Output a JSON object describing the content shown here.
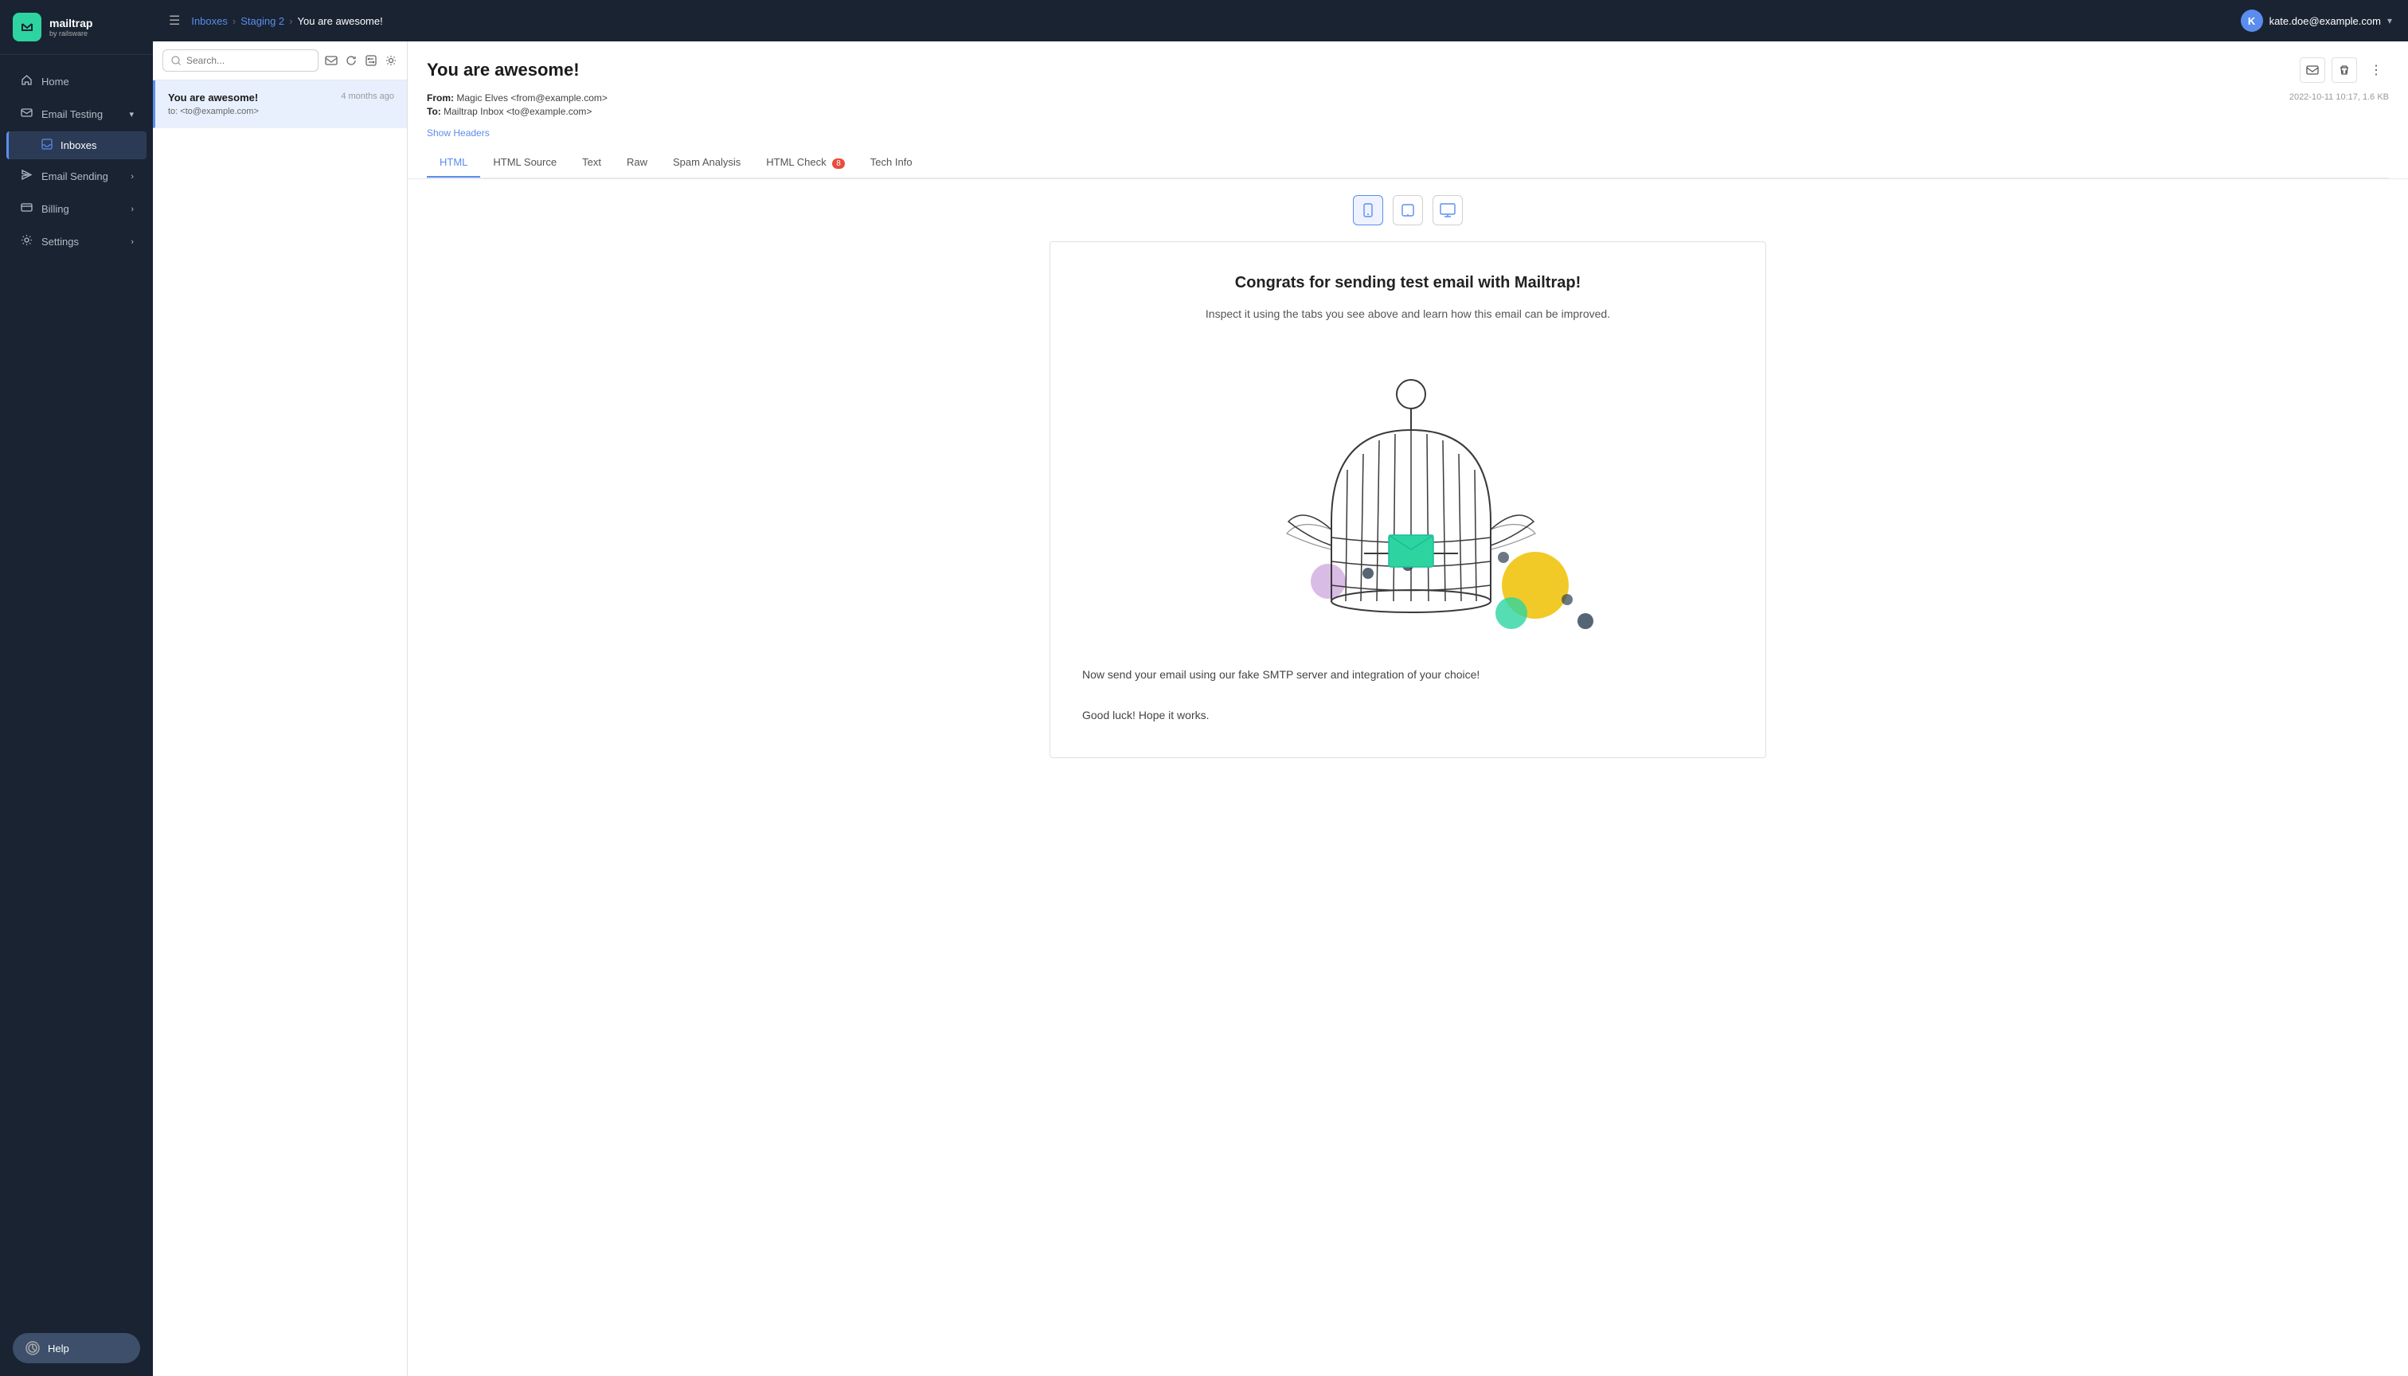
{
  "sidebar": {
    "logo": {
      "icon": "M",
      "main": "mailtrap",
      "sub": "by railsware"
    },
    "nav": [
      {
        "id": "home",
        "label": "Home",
        "icon": "🏠",
        "hasChevron": false
      },
      {
        "id": "email-testing",
        "label": "Email Testing",
        "icon": "✉️",
        "hasChevron": true,
        "expanded": true
      },
      {
        "id": "inboxes",
        "label": "Inboxes",
        "icon": "📥",
        "isSubItem": true,
        "active": true
      },
      {
        "id": "email-sending",
        "label": "Email Sending",
        "icon": "✈️",
        "hasChevron": true
      },
      {
        "id": "billing",
        "label": "Billing",
        "icon": "💳",
        "hasChevron": true
      },
      {
        "id": "settings",
        "label": "Settings",
        "icon": "⚙️",
        "hasChevron": true
      }
    ],
    "help_label": "Help"
  },
  "topbar": {
    "breadcrumb": {
      "inboxes": "Inboxes",
      "staging2": "Staging 2",
      "current": "You are awesome!"
    },
    "user": {
      "avatar": "K",
      "email": "kate.doe@example.com"
    }
  },
  "email_list": {
    "search_placeholder": "Search...",
    "items": [
      {
        "subject": "You are awesome!",
        "to": "to: <to@example.com>",
        "time": "4 months ago",
        "active": true
      }
    ]
  },
  "email_detail": {
    "title": "You are awesome!",
    "from": "Magic Elves <from@example.com>",
    "to": "Mailtrap Inbox <to@example.com>",
    "date": "2022-10-11 10:17, 1.6 KB",
    "show_headers": "Show Headers",
    "tabs": [
      {
        "id": "html",
        "label": "HTML",
        "active": true
      },
      {
        "id": "html-source",
        "label": "HTML Source",
        "active": false
      },
      {
        "id": "text",
        "label": "Text",
        "active": false
      },
      {
        "id": "raw",
        "label": "Raw",
        "active": false
      },
      {
        "id": "spam-analysis",
        "label": "Spam Analysis",
        "active": false
      },
      {
        "id": "html-check",
        "label": "HTML Check",
        "badge": "8",
        "active": false
      },
      {
        "id": "tech-info",
        "label": "Tech Info",
        "active": false
      }
    ],
    "body": {
      "congrats_title": "Congrats for sending test email with Mailtrap!",
      "congrats_text": "Inspect it using the tabs you see above and learn how this email can be improved.",
      "smtp_text": "Now send your email using our fake SMTP server and integration of your choice!",
      "good_luck": "Good luck! Hope it works."
    }
  }
}
